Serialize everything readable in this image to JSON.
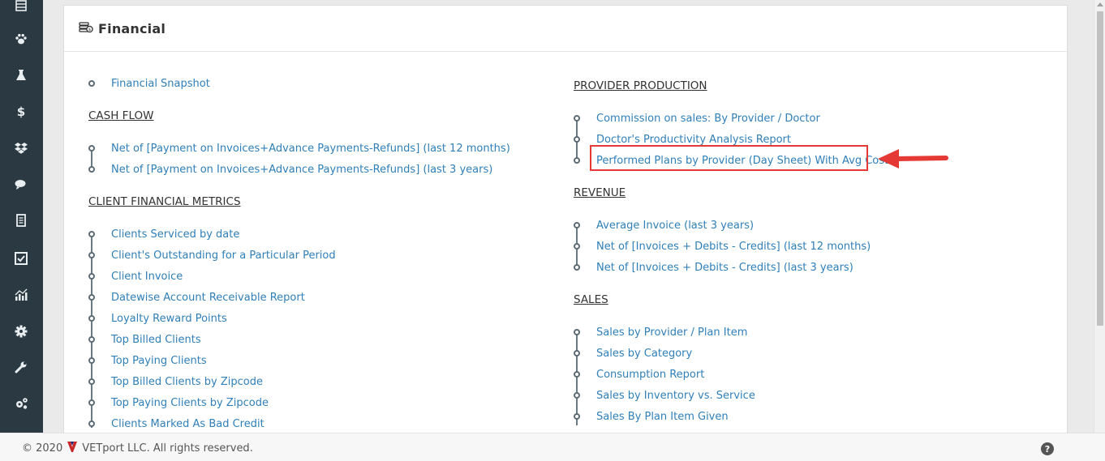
{
  "sidebar": {
    "icons": [
      "table-icon",
      "paw-icon",
      "flask-icon",
      "dollar-icon",
      "dropbox-icon",
      "chat-icon",
      "book-icon",
      "checkbox-icon",
      "chart-icon",
      "gear-icon",
      "wrench-icon",
      "gears-icon"
    ],
    "dollar_glyph": "$"
  },
  "panel": {
    "title": "Financial"
  },
  "left": {
    "top_items": [
      "Financial Snapshot"
    ],
    "cash_flow": {
      "title": "CASH FLOW",
      "items": [
        "Net of [Payment on Invoices+Advance Payments-Refunds] (last 12 months)",
        "Net of [Payment on Invoices+Advance Payments-Refunds] (last 3 years)"
      ]
    },
    "client_metrics": {
      "title": "CLIENT FINANCIAL METRICS",
      "items": [
        "Clients Serviced by date",
        "Client's Outstanding for a Particular Period",
        "Client Invoice",
        "Datewise Account Receivable Report",
        "Loyalty Reward Points",
        "Top Billed Clients",
        "Top Paying Clients",
        "Top Billed Clients by Zipcode",
        "Top Paying Clients by Zipcode",
        "Clients Marked As Bad Credit"
      ]
    }
  },
  "right": {
    "provider_production": {
      "title": "PROVIDER PRODUCTION",
      "items": [
        "Commission on sales: By Provider / Doctor",
        "Doctor's Productivity Analysis Report",
        "Performed Plans by Provider (Day Sheet) With Avg Cost"
      ]
    },
    "revenue": {
      "title": "REVENUE",
      "items": [
        "Average Invoice (last 3 years)",
        "Net of [Invoices + Debits - Credits] (last 12 months)",
        "Net of [Invoices + Debits - Credits] (last 3 years)"
      ]
    },
    "sales": {
      "title": "SALES",
      "items": [
        "Sales by Provider / Plan Item",
        "Sales by Category",
        "Consumption Report",
        "Sales by Inventory vs. Service",
        "Sales By Plan Item Given"
      ]
    }
  },
  "footer": {
    "copyright": "© 2020",
    "company": "VETport LLC. All rights reserved.",
    "help_glyph": "?"
  },
  "colors": {
    "sidebar": "#2b3a42",
    "link": "#2f7fb8",
    "highlight": "#e53935"
  }
}
